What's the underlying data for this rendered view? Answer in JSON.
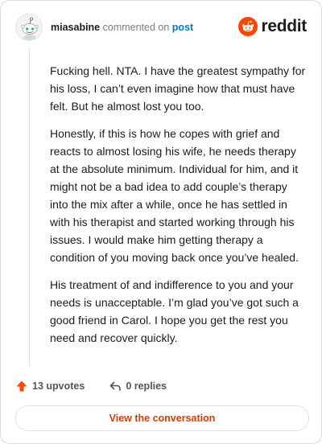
{
  "header": {
    "username": "miasabine",
    "action_text": "commented on",
    "post_link": "post",
    "brand": "reddit"
  },
  "colors": {
    "brand_orange": "#ff4500",
    "link_blue": "#0079d3",
    "button_text": "#d93a00"
  },
  "comment": {
    "paragraphs": [
      "Fucking hell. NTA. I have the greatest sympathy for his loss, I can’t even imagine how that must have felt. But he almost lost you too.",
      "Honestly, if this is how he copes with grief and reacts to almost losing his wife, he needs therapy at the absolute minimum. Individual for him, and it might not be a bad idea to add couple’s therapy into the mix after a while, once he has settled in with his therapist and started working through his issues. I would make him getting therapy a condition of you moving back once you’ve healed.",
      "His treatment of and indifference to you and your needs is unacceptable. I’m glad you’ve got such a good friend in Carol. I hope you get the rest you need and recover quickly."
    ]
  },
  "actions": {
    "upvotes": "13 upvotes",
    "replies": "0 replies"
  },
  "footer": {
    "view_button": "View the conversation"
  },
  "icons": {
    "avatar": "snoo-avatar-icon",
    "logo": "reddit-logo-icon",
    "upvote": "upvote-arrow-icon",
    "reply": "reply-arrow-icon"
  }
}
